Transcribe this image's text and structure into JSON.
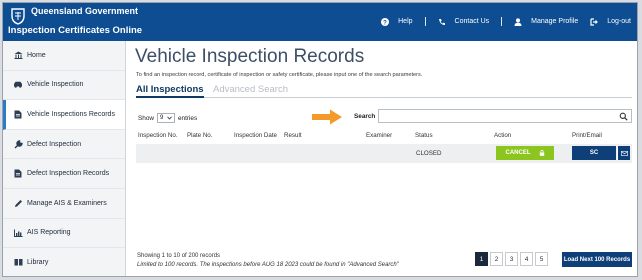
{
  "header": {
    "government": "Queensland Government",
    "app_title": "Inspection Certificates Online",
    "nav": [
      {
        "label": "Help",
        "icon": "help-icon"
      },
      {
        "label": "Contact Us",
        "icon": "phone-icon"
      },
      {
        "label": "Manage Profile",
        "icon": "user-icon"
      },
      {
        "label": "Log-out",
        "icon": "logout-icon"
      }
    ]
  },
  "sidebar": {
    "items": [
      {
        "label": "Home",
        "icon": "building-icon"
      },
      {
        "label": "Vehicle Inspection",
        "icon": "car-icon"
      },
      {
        "label": "Vehicle Inspections Records",
        "icon": "document-icon",
        "active": true
      },
      {
        "label": "Defect Inspection",
        "icon": "wrench-icon"
      },
      {
        "label": "Defect Inspection Records",
        "icon": "document-icon"
      },
      {
        "label": "Manage AIS & Examiners",
        "icon": "pencil-icon"
      },
      {
        "label": "AIS Reporting",
        "icon": "chart-icon"
      },
      {
        "label": "Library",
        "icon": "book-icon"
      }
    ]
  },
  "main": {
    "title": "Vehicle Inspection Records",
    "intro": "To find an inspection record, certificate of inspection or safety certificate, please input one of the search parameters.",
    "tabs": [
      "All Inspections",
      "Advanced Search"
    ],
    "show_label": "Show",
    "show_value": "9",
    "entries_label": "entries",
    "search_label": "Search",
    "search_value": "",
    "columns": [
      "Inspection No.",
      "Plate No.",
      "Inspection Date",
      "Result",
      "Examiner",
      "Status",
      "Action",
      "Print/Email"
    ],
    "rows": [
      {
        "inspection_no": "",
        "plate_no": "",
        "inspection_date": "",
        "result": "",
        "examiner": "",
        "status": "CLOSED",
        "action": "CANCEL",
        "print": "SC"
      }
    ],
    "footer": {
      "showing": "Showing 1 to 10 of 200 records",
      "note": "Limited to 100 records. The inspections before AUG 18 2023 could be found in \"Advanced Search\""
    },
    "pages": [
      "1",
      "2",
      "3",
      "4",
      "5"
    ],
    "current_page": "1",
    "load_more": "Load Next 100 Records"
  },
  "colors": {
    "header": "#0e4d92",
    "cancel": "#8cc51f",
    "primary_button": "#0e3f78",
    "arrow": "#f39a2b"
  }
}
